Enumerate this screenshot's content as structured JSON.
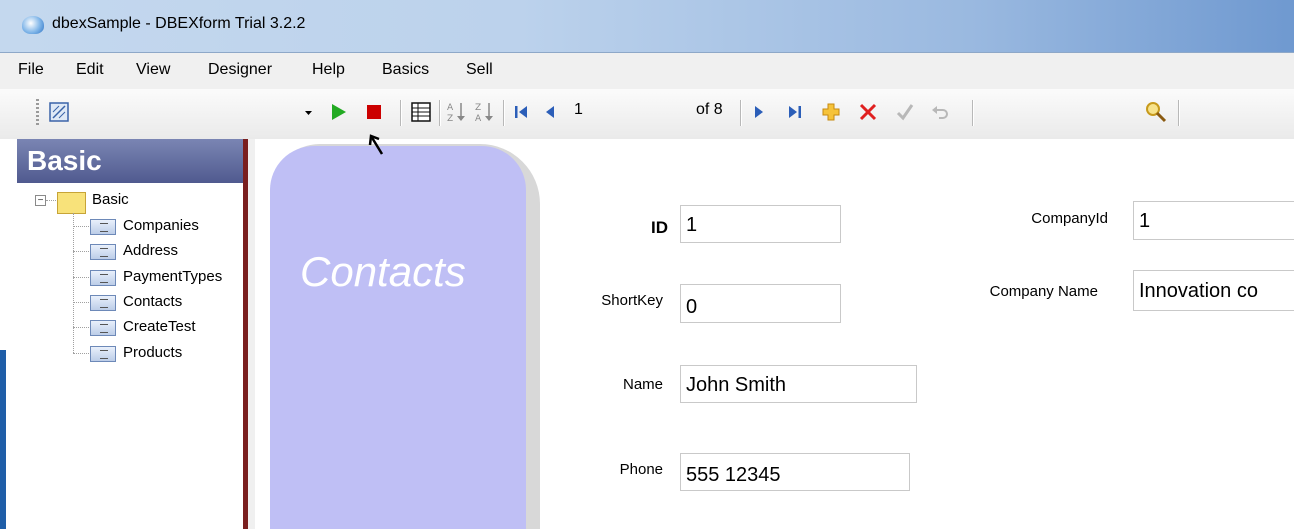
{
  "window": {
    "title": "dbexSample - DBEXform Trial 3.2.2"
  },
  "menu": {
    "items": [
      "File",
      "Edit",
      "View",
      "Designer",
      "Help",
      "Basics",
      "Sell"
    ]
  },
  "toolbar": {
    "record_current": "1",
    "record_total": "of 8",
    "icons": [
      "designer-icon",
      "dropdown-arrow-icon",
      "run-icon",
      "stop-icon",
      "grid-icon",
      "sort-ascending-icon",
      "sort-descending-icon",
      "first-record-icon",
      "previous-record-icon",
      "next-record-icon",
      "last-record-icon",
      "add-record-icon",
      "delete-record-icon",
      "save-record-icon",
      "undo-icon",
      "search-icon"
    ]
  },
  "sidebar": {
    "header": "Basic",
    "root": "Basic",
    "items": [
      "Companies",
      "Address",
      "PaymentTypes",
      "Contacts",
      "CreateTest",
      "Products"
    ],
    "selected": "Contacts"
  },
  "form": {
    "title": "Contacts",
    "fields": {
      "id": {
        "label": "ID",
        "value": "1"
      },
      "shortkey": {
        "label": "ShortKey",
        "value": "0"
      },
      "name": {
        "label": "Name",
        "value": "John Smith"
      },
      "phone": {
        "label": "Phone",
        "value": "555 12345"
      },
      "companyid": {
        "label": "CompanyId",
        "value": "1"
      },
      "companyname": {
        "label": "Company Name",
        "value": "Innovation co"
      }
    }
  },
  "colors": {
    "card": "#bfbff5",
    "panel_header": "#5a6496",
    "splitter": "#7a1f1f",
    "stop": "#cc0000",
    "run": "#22aa22"
  }
}
